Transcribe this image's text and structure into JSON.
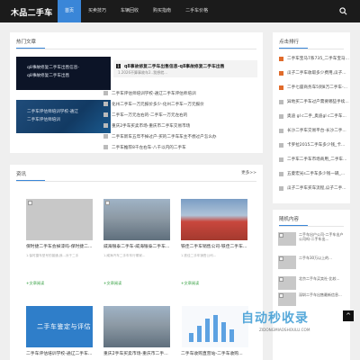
{
  "header": {
    "logo": "木品二手车",
    "nav": [
      "首页",
      "买卖技巧",
      "车辆回收",
      "购买指南",
      "二手车价格"
    ]
  },
  "hot": {
    "title": "热门文章",
    "images": [
      {
        "caption1": "q8事故修复二手车出售信息-",
        "caption2": "q8事故修复二手车出售"
      },
      {
        "caption1": "二手车评估师培训学校-通辽",
        "caption2": "二手车评估师培训"
      }
    ],
    "featured": {
      "num": "1",
      "title": "q8事故修复二手车出售信息-q8事故修复二手车出售",
      "desc": "1.2026不算事故车2..我想就..."
    },
    "list": [
      {
        "num": "2",
        "text": "二手车评估师培训学校-通辽二手车评估师培训"
      },
      {
        "num": "3",
        "text": "化州二手车一万元报价多少-化州二手车一万元报价"
      },
      {
        "num": "4",
        "text": "二手车一万元左右的-二手车一万元左右的"
      },
      {
        "num": "5",
        "text": "重庆2手车买卖市场-重庆市二手车交易市场"
      },
      {
        "num": "6",
        "text": "二手车新车五年不掉过户-买的二手车车主不想过户怎么办"
      },
      {
        "num": "7",
        "text": "二手车推荐8千左右车-八千以内的二手车"
      }
    ]
  },
  "ranking": {
    "title": "点击排行",
    "items": [
      "二手车宝马7系735_二手车宝马...",
      "瓜子二手车收取多少费用,瓜子...",
      "二手七座商务车5到8万二手车-...",
      "异地买二手车过户需要哪些手续...",
      "奥迪 gl c二手_奥迪gl c二手车...",
      "长沙二手车交易平台-长沙二手...",
      "卡罗拉2015二手车多少钱_卡...",
      "二手车二手车市场商用_二手车...",
      "五菱宏光s二手车多少钱一辆_...",
      "瓜子二手车买车流程,瓜子二手..."
    ]
  },
  "articles": {
    "title": "资讯",
    "more": "更多>>",
    "cards": [
      {
        "title": "保时捷二手车会掉漆吗-保时捷二...",
        "desc": "1.保时捷车型号的普通,我...对于二手",
        "link": "+文章阅读"
      },
      {
        "title": "威海银泰二手车-威海银泰二手车...",
        "desc": "1.威海汽车二手车车行哪家...",
        "link": "+文章阅读"
      },
      {
        "title": "铁佳二手车销售公司-铁佳二手车...",
        "desc": "1.铁佳二手车销售公司...",
        "link": "+文章阅读"
      },
      {
        "title": "二手车评估培训学校-通辽二手车...",
        "banner": "二手车鉴定与评估",
        "desc": "",
        "link": ""
      },
      {
        "title": "重庆2手车买卖市场-重庆市二手...",
        "desc": "",
        "link": ""
      },
      {
        "title": "二手车收购直营站-二手车收购...",
        "desc": "",
        "link": ""
      }
    ]
  },
  "random": {
    "title": "随机内容",
    "items": [
      "二手车出户公司-二手车出户公司吗-二手车出...",
      "二手车30万以上的...",
      "北京二手车买卖社-比较...",
      "深圳二手车出售最新信息..."
    ]
  },
  "watermark": {
    "logo": "自动秒收录",
    "sub": "ZIDONGMIAOSHOULU.COM"
  },
  "to_top": "^"
}
